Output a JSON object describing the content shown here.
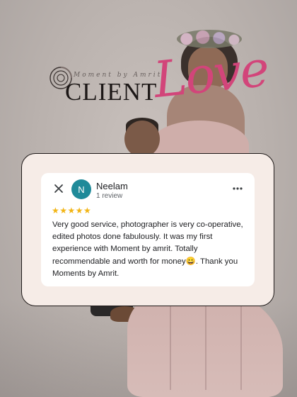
{
  "brand": {
    "logo_text": "Moment by Amrit",
    "title_word": "CLIENT",
    "title_script": "Love",
    "accent_color": "#d2457a"
  },
  "review": {
    "reviewer_name": "Neelam",
    "reviewer_initial": "N",
    "reviewer_meta": "1 review",
    "avatar_color": "#1f8a99",
    "rating_stars": "★★★★★",
    "rating": 5,
    "text": "Very good service, photographer  is very co-operative, edited photos  done fabulously. It was my first experience with Moment by amrit. Totally recommendable and worth for money😀. Thank you Moments by Amrit.",
    "close_icon": "close-icon",
    "menu_icon": "more-vert-icon"
  }
}
